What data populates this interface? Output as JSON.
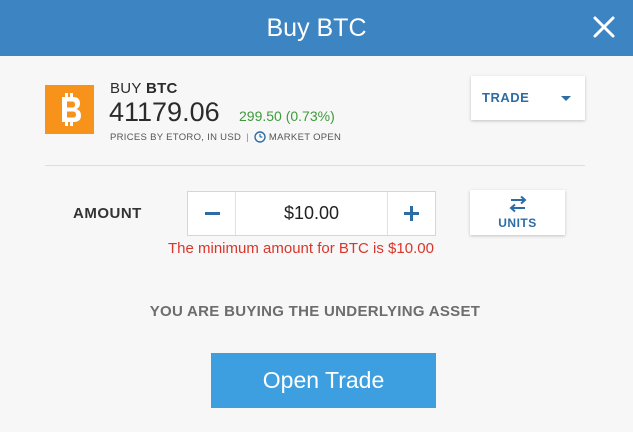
{
  "header": {
    "title": "Buy BTC",
    "close_icon": "close-icon"
  },
  "instrument": {
    "action": "BUY",
    "symbol": "BTC",
    "logo_icon": "bitcoin-icon",
    "price": "41179.06",
    "change": "299.50 (0.73%)",
    "prices_by": "PRICES BY ETORO, IN USD",
    "market_status": "MARKET OPEN"
  },
  "trade_dropdown": {
    "selected": "TRADE"
  },
  "amount": {
    "label": "AMOUNT",
    "value": "$10.00",
    "error": "The minimum amount for BTC is $10.00",
    "units_label": "UNITS"
  },
  "notice": "YOU ARE BUYING THE UNDERLYING ASSET",
  "open_trade_label": "Open Trade",
  "colors": {
    "header": "#3c84c2",
    "accent": "#2d6da5",
    "positive": "#3c9c3c",
    "error": "#d9362b",
    "button": "#3d9fe0",
    "bitcoin": "#f7931a"
  }
}
